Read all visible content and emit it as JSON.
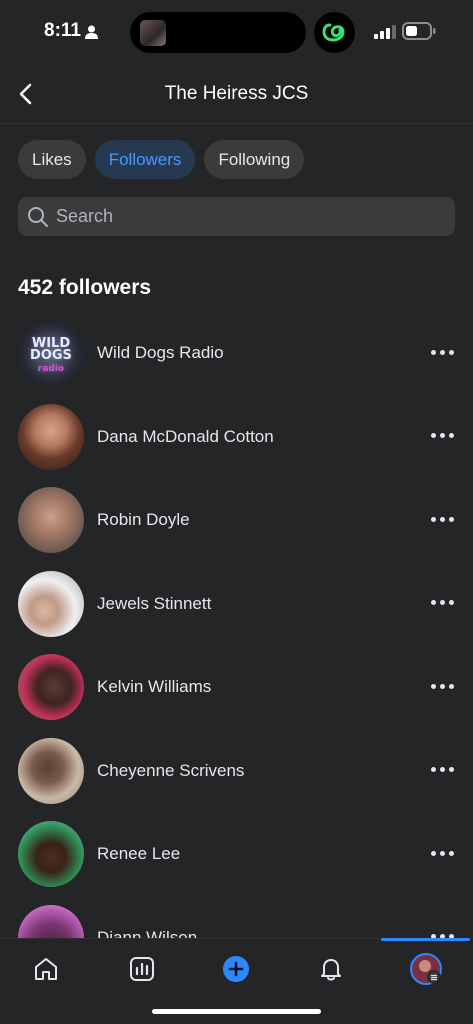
{
  "status_bar": {
    "time": "8:11"
  },
  "header": {
    "title": "The Heiress JCS"
  },
  "tabs": [
    {
      "label": "Likes",
      "active": false
    },
    {
      "label": "Followers",
      "active": true
    },
    {
      "label": "Following",
      "active": false
    }
  ],
  "search": {
    "placeholder": "Search",
    "value": ""
  },
  "follower_count": "452 followers",
  "followers": [
    {
      "name": "Wild Dogs Radio",
      "avatar_logo_text": "WILD DOGS RADIO"
    },
    {
      "name": "Dana McDonald Cotton"
    },
    {
      "name": "Robin Doyle"
    },
    {
      "name": "Jewels Stinnett"
    },
    {
      "name": "Kelvin Williams"
    },
    {
      "name": "Cheyenne Scrivens"
    },
    {
      "name": "Renee Lee"
    },
    {
      "name": "Diann Wilson"
    }
  ],
  "bottom_nav": [
    {
      "icon": "home-icon"
    },
    {
      "icon": "dashboard-icon"
    },
    {
      "icon": "create-post-icon"
    },
    {
      "icon": "notifications-bell-icon"
    },
    {
      "icon": "profile-avatar-icon",
      "active": true
    }
  ],
  "colors": {
    "background": "#242526",
    "surface": "#3a3b3c",
    "accent": "#2d88ff",
    "active_tab_text": "#4599ff",
    "active_tab_bg": "#263951",
    "threads_badge_green": "#3de06d"
  }
}
